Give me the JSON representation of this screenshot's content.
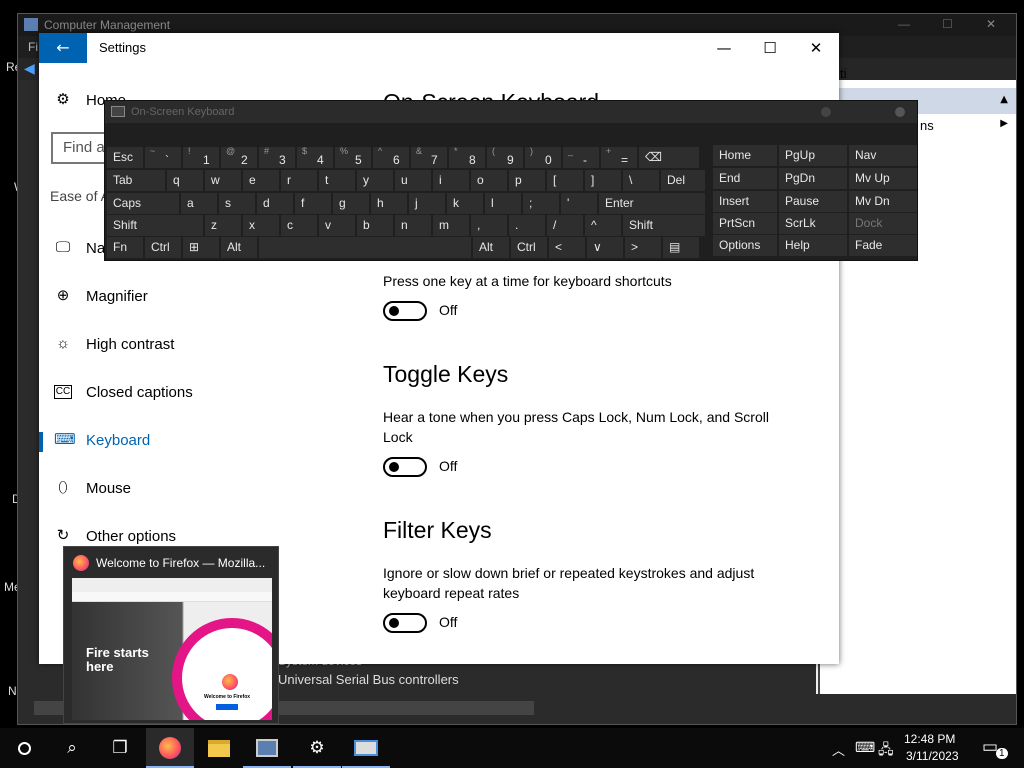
{
  "desktop": {
    "left_labels": [
      "Re",
      "W",
      "D",
      "Me",
      "N"
    ]
  },
  "computer_management": {
    "title": "Computer Management",
    "menu_first": "Fi",
    "tree_item": "Universal Serial Bus controllers",
    "tree_item_above": "System devices",
    "right_partial_1": "ti",
    "right_partial_2": "ns"
  },
  "settings": {
    "title": "Settings",
    "back_label": "←",
    "minimize": "—",
    "maximize": "☐",
    "close": "✕",
    "home": "Home",
    "search_placeholder": "Find a setting",
    "category": "Ease of Access",
    "nav": [
      {
        "label": "Narrator",
        "icon": "narrator-icon"
      },
      {
        "label": "Magnifier",
        "icon": "magnifier-icon"
      },
      {
        "label": "High contrast",
        "icon": "high-contrast-icon"
      },
      {
        "label": "Closed captions",
        "icon": "closed-captions-icon"
      },
      {
        "label": "Keyboard",
        "icon": "keyboard-icon",
        "selected": true
      },
      {
        "label": "Mouse",
        "icon": "mouse-icon"
      },
      {
        "label": "Other options",
        "icon": "other-options-icon"
      }
    ],
    "page_heading": "On-Screen Keyboard",
    "sticky_desc": "Press one key at a time for keyboard shortcuts",
    "sticky_state": "Off",
    "toggle_keys_title": "Toggle Keys",
    "toggle_keys_desc_1": "Hear a tone when you press Caps Lock, Num Lock, and Scroll",
    "toggle_keys_desc_2": "Lock",
    "toggle_keys_state": "Off",
    "filter_keys_title": "Filter Keys",
    "filter_keys_desc_1": "Ignore or slow down brief or repeated keystrokes and adjust",
    "filter_keys_desc_2": "keyboard repeat rates",
    "filter_keys_state": "Off"
  },
  "osk": {
    "title": "On-Screen Keyboard",
    "row1": [
      {
        "t": "Esc"
      },
      {
        "s": "~",
        "m": "`"
      },
      {
        "s": "!",
        "m": "1"
      },
      {
        "s": "@",
        "m": "2"
      },
      {
        "s": "#",
        "m": "3"
      },
      {
        "s": "$",
        "m": "4"
      },
      {
        "s": "%",
        "m": "5"
      },
      {
        "s": "^",
        "m": "6"
      },
      {
        "s": "&",
        "m": "7"
      },
      {
        "s": "*",
        "m": "8"
      },
      {
        "s": "(",
        "m": "9"
      },
      {
        "s": ")",
        "m": "0"
      },
      {
        "s": "_",
        "m": "-"
      },
      {
        "s": "+",
        "m": "="
      },
      {
        "t": "⌫"
      }
    ],
    "row2": [
      "Tab",
      "q",
      "w",
      "e",
      "r",
      "t",
      "y",
      "u",
      "i",
      "o",
      "p",
      "[",
      "]",
      "\\",
      "Del"
    ],
    "row3": [
      "Caps",
      "a",
      "s",
      "d",
      "f",
      "g",
      "h",
      "j",
      "k",
      "l",
      ";",
      "'",
      "Enter"
    ],
    "row4": [
      "Shift",
      "z",
      "x",
      "c",
      "v",
      "b",
      "n",
      "m",
      ",",
      ".",
      "/",
      "^",
      "Shift"
    ],
    "row5": [
      "Fn",
      "Ctrl",
      "⊞",
      "Alt",
      "",
      "Alt",
      "Ctrl",
      "<",
      "∨",
      ">",
      "▤"
    ],
    "nav_col1": [
      "Home",
      "End",
      "Insert",
      "PrtScn",
      "Options"
    ],
    "nav_col2": [
      "PgUp",
      "PgDn",
      "Pause",
      "ScrLk",
      "Help"
    ],
    "nav_col3": [
      "Nav",
      "Mv Up",
      "Mv Dn",
      "Dock",
      "Fade"
    ]
  },
  "firefox_preview": {
    "title": "Welcome to Firefox — Mozilla...",
    "hero_text_1": "Fire starts",
    "hero_text_2": "here",
    "card_text": "Welcome to Firefox"
  },
  "taskbar": {
    "time": "12:48 PM",
    "date": "3/11/2023",
    "notification_count": "1"
  }
}
